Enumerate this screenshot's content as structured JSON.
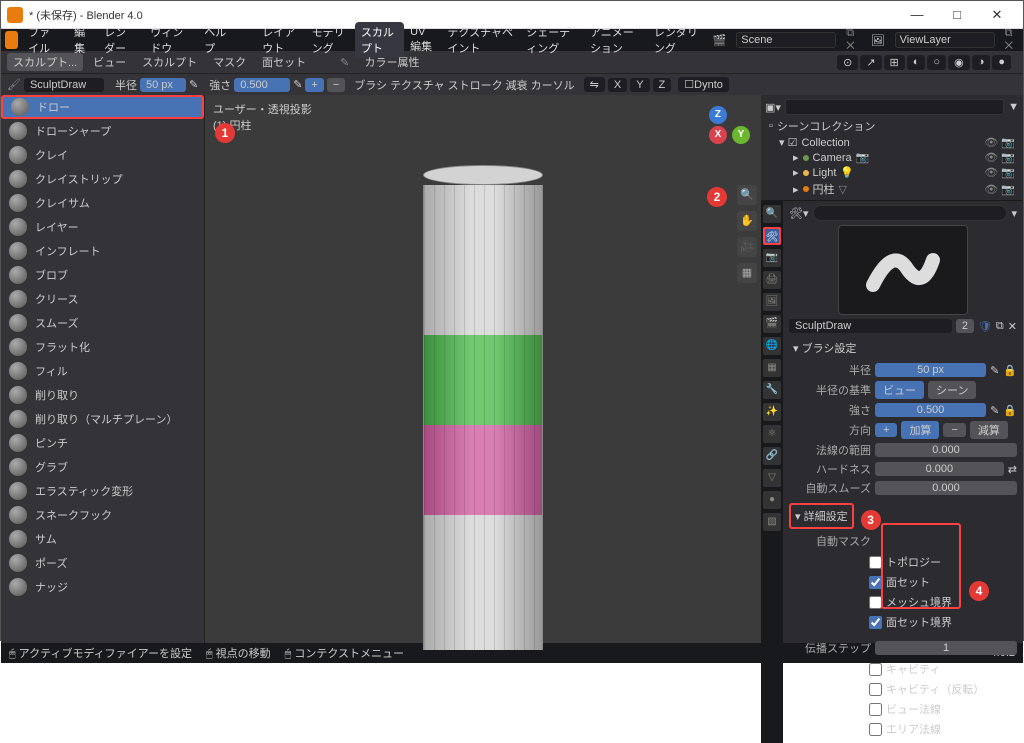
{
  "window": {
    "title": "* (未保存) - Blender 4.0"
  },
  "menubar": {
    "items": [
      "ファイル",
      "編集",
      "レンダー",
      "ウィンドウ",
      "ヘルプ"
    ]
  },
  "workspace_tabs": [
    "レイアウト",
    "モデリング",
    "スカルプト",
    "UV編集",
    "テクスチャペイント",
    "シェーディング",
    "アニメーション",
    "レンダリング"
  ],
  "active_tab": "スカルプト",
  "scene_dropdown": "Scene",
  "viewlayer": "ViewLayer",
  "header2": {
    "mode": "スカルプト...",
    "menus": [
      "ビュー",
      "スカルプト",
      "マスク",
      "面セット"
    ],
    "color": "カラー属性"
  },
  "header3": {
    "brush": "SculptDraw",
    "radius_label": "半径",
    "radius": "50 px",
    "strength_label": "強さ",
    "strength": "0.500",
    "brushm": "ブラシ",
    "texture": "テクスチャ",
    "stroke": "ストローク",
    "falloff": "減衰",
    "cursor": "カーソル",
    "dynto": "Dynto"
  },
  "tools": [
    "ドロー",
    "ドローシャープ",
    "クレイ",
    "クレイストリップ",
    "クレイサム",
    "レイヤー",
    "インフレート",
    "ブロブ",
    "クリース",
    "スムーズ",
    "フラット化",
    "フィル",
    "削り取り",
    "削り取り（マルチプレーン）",
    "ピンチ",
    "グラブ",
    "エラスティック変形",
    "スネークフック",
    "サム",
    "ポーズ",
    "ナッジ"
  ],
  "active_tool_index": 0,
  "viewport": {
    "projection": "ユーザー・透視投影",
    "object": "(1) 円柱"
  },
  "outliner": {
    "header": "シーンコレクション",
    "collection": "Collection",
    "items": [
      {
        "name": "Camera",
        "icon": "camera"
      },
      {
        "name": "Light",
        "icon": "light"
      },
      {
        "name": "円柱",
        "icon": "mesh"
      }
    ]
  },
  "properties": {
    "search_placeholder": "",
    "brush_name": "SculptDraw",
    "brush_users": "2",
    "section": "ブラシ設定",
    "radius_label": "半径",
    "radius": "50 px",
    "radius_unit_label": "半径の基準",
    "unit_view": "ビュー",
    "unit_scene": "シーン",
    "strength_label": "強さ",
    "strength": "0.500",
    "direction_label": "方向",
    "dir_add": "加算",
    "dir_sub": "減算",
    "normal_label": "法線の範囲",
    "normal": "0.000",
    "hardness_label": "ハードネス",
    "hardness": "0.000",
    "autosmooth_label": "自動スムーズ",
    "autosmooth": "0.000",
    "advanced": "詳細設定",
    "automask_label": "自動マスク",
    "checks": [
      {
        "label": "トポロジー",
        "checked": false
      },
      {
        "label": "面セット",
        "checked": true
      },
      {
        "label": "メッシュ境界",
        "checked": false
      },
      {
        "label": "面セット境界",
        "checked": true
      }
    ],
    "propag_label": "伝播ステップ",
    "propag": "1",
    "extra": [
      "キャビティ",
      "キャビティ（反転）",
      "ビュー法線",
      "エリア法線"
    ]
  },
  "statusbar": {
    "left": "アクティブモディファイアーを設定",
    "mid": "視点の移動",
    "mid2": "コンテクストメニュー",
    "version": "4.0.2"
  },
  "annotations": {
    "1": "1",
    "2": "2",
    "3": "3",
    "4": "4"
  }
}
